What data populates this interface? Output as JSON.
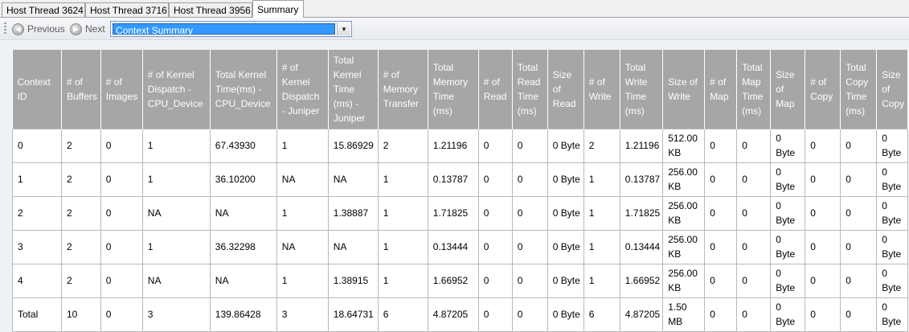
{
  "tabs": [
    {
      "label": "Host Thread 3624",
      "active": false
    },
    {
      "label": "Host Thread 3716",
      "active": false
    },
    {
      "label": "Host Thread 3956",
      "active": false
    },
    {
      "label": "Summary",
      "active": true
    }
  ],
  "toolbar": {
    "previous_label": "Previous",
    "next_label": "Next",
    "view_select_value": "Context Summary"
  },
  "table": {
    "columns": [
      "Context ID",
      "# of Buffers",
      "# of Images",
      "# of Kernel Dispatch - CPU_Device",
      "Total Kernel Time(ms) - CPU_Device",
      "# of Kernel Dispatch - Juniper",
      "Total Kernel Time (ms) - Juniper",
      "# of Memory Transfer",
      "Total Memory Time (ms)",
      "# of Read",
      "Total Read Time (ms)",
      "Size of Read",
      "# of Write",
      "Total Write Time (ms)",
      "Size of Write",
      "# of Map",
      "Total Map Time (ms)",
      "Size of Map",
      "# of Copy",
      "Total Copy Time (ms)",
      "Size of Copy"
    ],
    "rows": [
      [
        "0",
        "2",
        "0",
        "1",
        "67.43930",
        "1",
        "15.86929",
        "2",
        "1.21196",
        "0",
        "0",
        "0 Byte",
        "2",
        "1.21196",
        "512.00 KB",
        "0",
        "0",
        "0 Byte",
        "0",
        "0",
        "0 Byte"
      ],
      [
        "1",
        "2",
        "0",
        "1",
        "36.10200",
        "NA",
        "NA",
        "1",
        "0.13787",
        "0",
        "0",
        "0 Byte",
        "1",
        "0.13787",
        "256.00 KB",
        "0",
        "0",
        "0 Byte",
        "0",
        "0",
        "0 Byte"
      ],
      [
        "2",
        "2",
        "0",
        "NA",
        "NA",
        "1",
        "1.38887",
        "1",
        "1.71825",
        "0",
        "0",
        "0 Byte",
        "1",
        "1.71825",
        "256.00 KB",
        "0",
        "0",
        "0 Byte",
        "0",
        "0",
        "0 Byte"
      ],
      [
        "3",
        "2",
        "0",
        "1",
        "36.32298",
        "NA",
        "NA",
        "1",
        "0.13444",
        "0",
        "0",
        "0 Byte",
        "1",
        "0.13444",
        "256.00 KB",
        "0",
        "0",
        "0 Byte",
        "0",
        "0",
        "0 Byte"
      ],
      [
        "4",
        "2",
        "0",
        "NA",
        "NA",
        "1",
        "1.38915",
        "1",
        "1.66952",
        "0",
        "0",
        "0 Byte",
        "1",
        "1.66952",
        "256.00 KB",
        "0",
        "0",
        "0 Byte",
        "0",
        "0",
        "0 Byte"
      ],
      [
        "Total",
        "10",
        "0",
        "3",
        "139.86428",
        "3",
        "18.64731",
        "6",
        "4.87205",
        "0",
        "0",
        "0 Byte",
        "6",
        "4.87205",
        "1.50 MB",
        "0",
        "0",
        "0 Byte",
        "0",
        "0",
        "0 Byte"
      ]
    ]
  },
  "colors": {
    "header_bg": "#a6a6a6",
    "header_text": "#ffffff",
    "selection": "#3399ff",
    "content_bg": "#eef1f5"
  }
}
